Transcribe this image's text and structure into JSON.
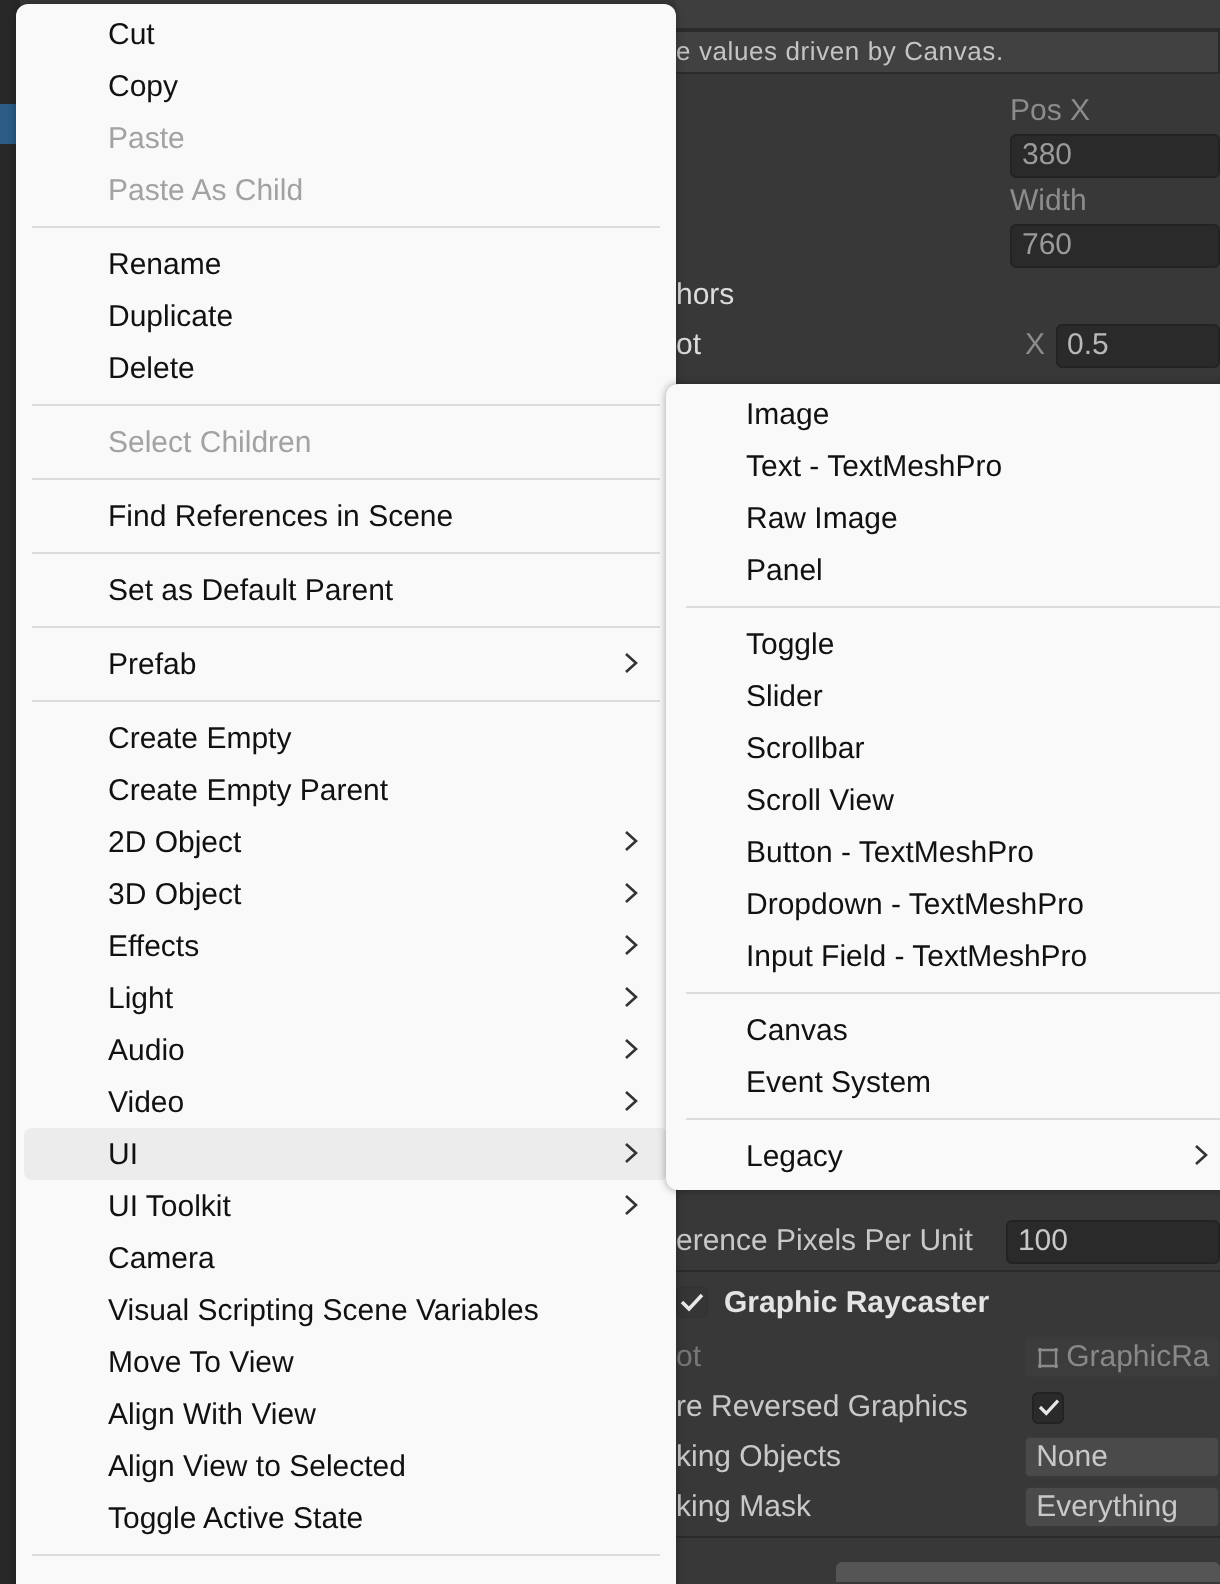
{
  "inspector": {
    "info_text": "e values driven by Canvas.",
    "top_rows": [
      {
        "kind": "caption",
        "label": "",
        "value": "Pos X"
      },
      {
        "kind": "field",
        "label": "",
        "value": "380"
      },
      {
        "kind": "caption",
        "label": "",
        "value": "Width"
      },
      {
        "kind": "field",
        "label": "",
        "value": "760"
      },
      {
        "kind": "label",
        "label": "hors",
        "value": ""
      },
      {
        "kind": "axis",
        "label": "ot",
        "axis": "X",
        "value": "0.5"
      }
    ],
    "bottom_rows": [
      {
        "kind": "field",
        "label": "erence Pixels Per Unit",
        "value": "100"
      },
      {
        "kind": "component",
        "label": "Graphic Raycaster",
        "checked": true
      },
      {
        "kind": "script",
        "label": "ot",
        "value": "GraphicRa"
      },
      {
        "kind": "checkbox",
        "label": "re Reversed Graphics",
        "checked": true
      },
      {
        "kind": "dropdown",
        "label": "king Objects",
        "value": "None"
      },
      {
        "kind": "dropdown",
        "label": "king Mask",
        "value": "Everything"
      }
    ]
  },
  "context_menu": {
    "sections": [
      [
        {
          "label": "Cut",
          "disabled": false,
          "submenu": false,
          "selected": false
        },
        {
          "label": "Copy",
          "disabled": false,
          "submenu": false,
          "selected": false
        },
        {
          "label": "Paste",
          "disabled": true,
          "submenu": false,
          "selected": false
        },
        {
          "label": "Paste As Child",
          "disabled": true,
          "submenu": false,
          "selected": false
        }
      ],
      [
        {
          "label": "Rename",
          "disabled": false,
          "submenu": false,
          "selected": false
        },
        {
          "label": "Duplicate",
          "disabled": false,
          "submenu": false,
          "selected": false
        },
        {
          "label": "Delete",
          "disabled": false,
          "submenu": false,
          "selected": false
        }
      ],
      [
        {
          "label": "Select Children",
          "disabled": true,
          "submenu": false,
          "selected": false
        }
      ],
      [
        {
          "label": "Find References in Scene",
          "disabled": false,
          "submenu": false,
          "selected": false
        }
      ],
      [
        {
          "label": "Set as Default Parent",
          "disabled": false,
          "submenu": false,
          "selected": false
        }
      ],
      [
        {
          "label": "Prefab",
          "disabled": false,
          "submenu": true,
          "selected": false
        }
      ],
      [
        {
          "label": "Create Empty",
          "disabled": false,
          "submenu": false,
          "selected": false
        },
        {
          "label": "Create Empty Parent",
          "disabled": false,
          "submenu": false,
          "selected": false
        },
        {
          "label": "2D Object",
          "disabled": false,
          "submenu": true,
          "selected": false
        },
        {
          "label": "3D Object",
          "disabled": false,
          "submenu": true,
          "selected": false
        },
        {
          "label": "Effects",
          "disabled": false,
          "submenu": true,
          "selected": false
        },
        {
          "label": "Light",
          "disabled": false,
          "submenu": true,
          "selected": false
        },
        {
          "label": "Audio",
          "disabled": false,
          "submenu": true,
          "selected": false
        },
        {
          "label": "Video",
          "disabled": false,
          "submenu": true,
          "selected": false
        },
        {
          "label": "UI",
          "disabled": false,
          "submenu": true,
          "selected": true
        },
        {
          "label": "UI Toolkit",
          "disabled": false,
          "submenu": true,
          "selected": false
        },
        {
          "label": "Camera",
          "disabled": false,
          "submenu": false,
          "selected": false
        },
        {
          "label": "Visual Scripting Scene Variables",
          "disabled": false,
          "submenu": false,
          "selected": false
        },
        {
          "label": "Move To View",
          "disabled": false,
          "submenu": false,
          "selected": false
        },
        {
          "label": "Align With View",
          "disabled": false,
          "submenu": false,
          "selected": false
        },
        {
          "label": "Align View to Selected",
          "disabled": false,
          "submenu": false,
          "selected": false
        },
        {
          "label": "Toggle Active State",
          "disabled": false,
          "submenu": false,
          "selected": false
        }
      ]
    ]
  },
  "ui_submenu": {
    "sections": [
      [
        {
          "label": "Image",
          "submenu": false
        },
        {
          "label": "Text - TextMeshPro",
          "submenu": false
        },
        {
          "label": "Raw Image",
          "submenu": false
        },
        {
          "label": "Panel",
          "submenu": false
        }
      ],
      [
        {
          "label": "Toggle",
          "submenu": false
        },
        {
          "label": "Slider",
          "submenu": false
        },
        {
          "label": "Scrollbar",
          "submenu": false
        },
        {
          "label": "Scroll View",
          "submenu": false
        },
        {
          "label": "Button - TextMeshPro",
          "submenu": false
        },
        {
          "label": "Dropdown - TextMeshPro",
          "submenu": false
        },
        {
          "label": "Input Field - TextMeshPro",
          "submenu": false
        }
      ],
      [
        {
          "label": "Canvas",
          "submenu": false
        },
        {
          "label": "Event System",
          "submenu": false
        }
      ],
      [
        {
          "label": "Legacy",
          "submenu": true
        }
      ]
    ]
  }
}
